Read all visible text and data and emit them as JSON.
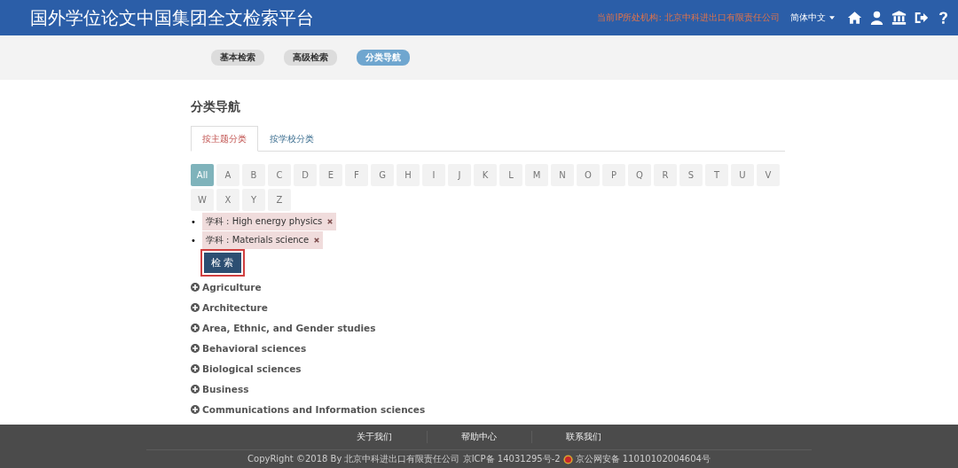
{
  "header": {
    "title": "国外学位论文中国集团全文检索平台",
    "ip_institution": "当前IP所处机构: 北京中科进出口有限责任公司",
    "language": "简体中文"
  },
  "nav": [
    {
      "label": "基本检索",
      "selected": false
    },
    {
      "label": "高级检索",
      "selected": false
    },
    {
      "label": "分类导航",
      "selected": true
    }
  ],
  "page_title": "分类导航",
  "tabs": [
    {
      "label": "按主题分类",
      "selected": true
    },
    {
      "label": "按学校分类",
      "selected": false
    }
  ],
  "letters": [
    {
      "label": "All",
      "selected": true
    },
    {
      "label": "A",
      "selected": false
    },
    {
      "label": "B",
      "selected": false
    },
    {
      "label": "C",
      "selected": false
    },
    {
      "label": "D",
      "selected": false
    },
    {
      "label": "E",
      "selected": false
    },
    {
      "label": "F",
      "selected": false
    },
    {
      "label": "G",
      "selected": false
    },
    {
      "label": "H",
      "selected": false
    },
    {
      "label": "I",
      "selected": false
    },
    {
      "label": "J",
      "selected": false
    },
    {
      "label": "K",
      "selected": false
    },
    {
      "label": "L",
      "selected": false
    },
    {
      "label": "M",
      "selected": false
    },
    {
      "label": "N",
      "selected": false
    },
    {
      "label": "O",
      "selected": false
    },
    {
      "label": "P",
      "selected": false
    },
    {
      "label": "Q",
      "selected": false
    },
    {
      "label": "R",
      "selected": false
    },
    {
      "label": "S",
      "selected": false
    },
    {
      "label": "T",
      "selected": false
    },
    {
      "label": "U",
      "selected": false
    },
    {
      "label": "V",
      "selected": false
    },
    {
      "label": "W",
      "selected": false
    },
    {
      "label": "X",
      "selected": false
    },
    {
      "label": "Y",
      "selected": false
    },
    {
      "label": "Z",
      "selected": false
    }
  ],
  "filters": [
    {
      "marker": "•",
      "text": "学科 : High energy physics"
    },
    {
      "marker": "•",
      "text": "学科 : Materials science"
    }
  ],
  "search_button": "检 索",
  "categories": [
    "Agriculture",
    "Architecture",
    "Area, Ethnic, and Gender studies",
    "Behavioral sciences",
    "Biological sciences",
    "Business",
    "Communications and Information sciences"
  ],
  "footer": {
    "links": [
      "关于我们",
      "帮助中心",
      "联系我们"
    ],
    "copyright": "CopyRight ©2018 By 北京中科进出口有限责任公司 京ICP备 14031295号-2",
    "police_record": "京公网安备 11010102004604号"
  }
}
